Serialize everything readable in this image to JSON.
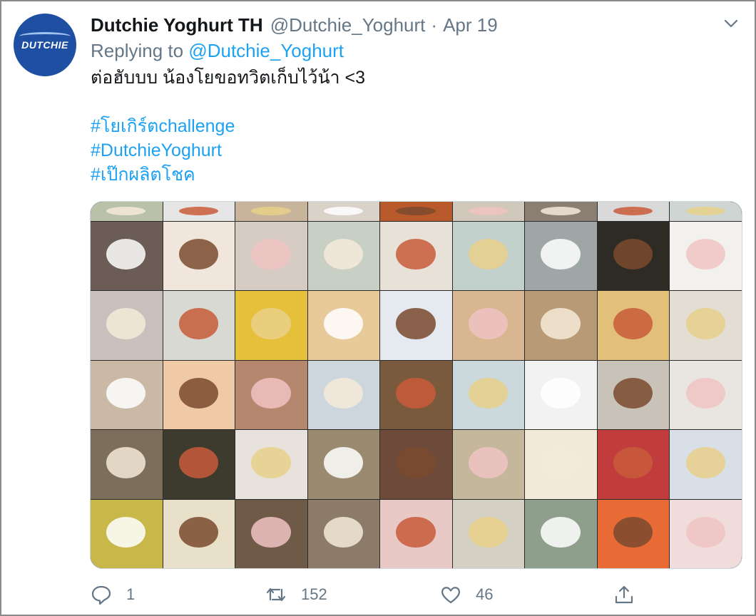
{
  "tweet": {
    "avatar_brand": "DUTCHIE",
    "display_name": "Dutchie Yoghurt TH",
    "handle": "@Dutchie_Yoghurt",
    "separator": "·",
    "date": "Apr 19",
    "reply_prefix": "Replying to",
    "reply_mention": "@Dutchie_Yoghurt",
    "text": "ต่อฮับบบ น้องโยขอทวิตเก็บไว้น้า <3",
    "hashtags": [
      "#โยเกิร์ตchallenge",
      "#DutchieYoghurt",
      "#เป๊กผลิตโชค"
    ]
  },
  "media": {
    "description_colors": [
      [
        "#b9c2a8",
        "#e6e6e6",
        "#c7b49a",
        "#d8d2c9",
        "#b85a2c",
        "#cfc8bb",
        "#8a7f72",
        "#d9d9d9",
        "#cfd5d2"
      ],
      [
        "#6b5c55",
        "#f1e6dc",
        "#d7ccc4",
        "#c8d0c6",
        "#e7e1d8",
        "#c3d1cc",
        "#9ea6a6",
        "#2e2a24",
        "#f3f1ee"
      ],
      [
        "#c9c0bd",
        "#d7d9d2",
        "#e6c03b",
        "#e7c99a",
        "#e5eaf1",
        "#d8b690",
        "#b89a76",
        "#e3c07a",
        "#e4ddd3"
      ],
      [
        "#c9b9a5",
        "#f0c9a6",
        "#b5876e",
        "#cdd6dd",
        "#7a5a3c",
        "#cbd8dc",
        "#f2f2f2",
        "#c9c2b8",
        "#e9e6e2"
      ],
      [
        "#7c6e5a",
        "#3c3b2e",
        "#e7e3dc",
        "#9a8a6f",
        "#6d4a3a",
        "#c4b79c",
        "#f2e9d9",
        "#c13d3d",
        "#d9dfe6"
      ],
      [
        "#c8b84a",
        "#e8e0c8",
        "#6f5a48",
        "#8d7b6a",
        "#e8c9c6",
        "#d4d1c4",
        "#8ea08c",
        "#e86a35",
        "#f1dcdc"
      ]
    ]
  },
  "actions": {
    "reply_count": "1",
    "retweet_count": "152",
    "like_count": "46"
  },
  "colors": {
    "accent": "#1da1f2",
    "secondary_text": "#657786",
    "avatar_bg": "#1e4fa3"
  }
}
